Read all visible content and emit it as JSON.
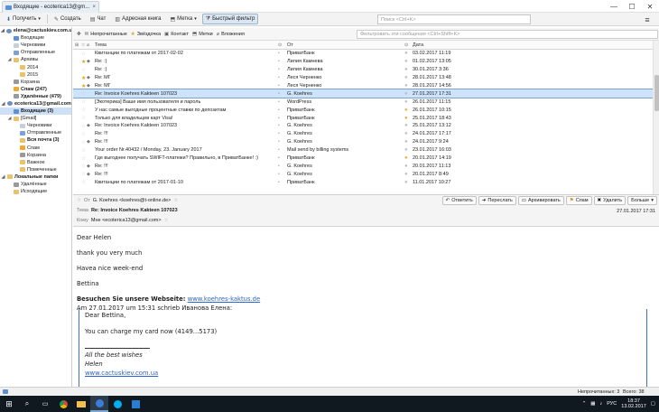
{
  "window": {
    "tab_title": "Входящие - ecoterica13@gm...",
    "close": "×",
    "minimize": "—",
    "maximize": "☐",
    "close_window": "✕"
  },
  "toolbar": {
    "get": "Получить",
    "create": "Создать",
    "chat": "Чат",
    "address_book": "Адресная книга",
    "tag": "Метка",
    "quick_filter": "Быстрый фильтр",
    "search_placeholder": "Поиск <Ctrl+K>",
    "menu_glyph": "≡"
  },
  "folders": [
    {
      "label": "elena@cactuskiev.com.ua",
      "indent": 0,
      "icon": "acct",
      "bold": true,
      "twisty": "◢"
    },
    {
      "label": "Входящие",
      "indent": 1,
      "icon": "inbox"
    },
    {
      "label": "Черновики",
      "indent": 1,
      "icon": "draft"
    },
    {
      "label": "Отправленные",
      "indent": 1,
      "icon": "sent"
    },
    {
      "label": "Архивы",
      "indent": 1,
      "icon": "folder",
      "twisty": "◢"
    },
    {
      "label": "2014",
      "indent": 2,
      "icon": "folder"
    },
    {
      "label": "2015",
      "indent": 2,
      "icon": "folder"
    },
    {
      "label": "Корзина",
      "indent": 1,
      "icon": "trash"
    },
    {
      "label": "Спам (247)",
      "indent": 1,
      "icon": "junk",
      "bold": true
    },
    {
      "label": "Удалённые (479)",
      "indent": 1,
      "icon": "trash",
      "bold": true
    },
    {
      "label": "ecoterica13@gmail.com",
      "indent": 0,
      "icon": "acct",
      "bold": true,
      "twisty": "◢"
    },
    {
      "label": "Входящие (3)",
      "indent": 1,
      "icon": "inbox",
      "bold": true,
      "selected": true
    },
    {
      "label": "[Gmail]",
      "indent": 1,
      "icon": "folder",
      "twisty": "◢"
    },
    {
      "label": "Черновики",
      "indent": 2,
      "icon": "draft"
    },
    {
      "label": "Отправленные",
      "indent": 2,
      "icon": "sent"
    },
    {
      "label": "Вся почта (3)",
      "indent": 2,
      "icon": "folder",
      "bold": true
    },
    {
      "label": "Спам",
      "indent": 2,
      "icon": "junk"
    },
    {
      "label": "Корзина",
      "indent": 2,
      "icon": "trash"
    },
    {
      "label": "Важное",
      "indent": 2,
      "icon": "folder"
    },
    {
      "label": "Помеченные",
      "indent": 2,
      "icon": "folder"
    },
    {
      "label": "Локальные папки",
      "indent": 0,
      "icon": "folder",
      "bold": true,
      "twisty": "◢"
    },
    {
      "label": "Удалённые",
      "indent": 1,
      "icon": "trash"
    },
    {
      "label": "Исходящие",
      "indent": 1,
      "icon": "folder"
    }
  ],
  "quickfilter": {
    "unread": "Непрочитанные",
    "starred": "Звёздочка",
    "contact": "Контакт",
    "tags": "Метки",
    "attachments": "Вложения",
    "search_placeholder": "Фильтровать эти сообщения <Ctrl+Shift+K>"
  },
  "thread_columns": {
    "subject": "Тема",
    "from": "От",
    "date": "Дата"
  },
  "messages": [
    {
      "star": false,
      "att": "",
      "subject": "Квитанции по платежам от 2017-02-02",
      "from": "ПриватБанк",
      "date": "03.02.2017 11:19"
    },
    {
      "star": true,
      "att": "◆",
      "subject": "Re: :)",
      "from": "Лилия Камнева",
      "date": "01.02.2017 13:05"
    },
    {
      "star": false,
      "att": "",
      "subject": "Re: :)",
      "from": "Лилия Камнева",
      "date": "30.01.2017 3:36"
    },
    {
      "star": true,
      "att": "◆",
      "subject": "Re: МГ",
      "from": "Леся Черненко",
      "date": "28.01.2017 13:48"
    },
    {
      "star": true,
      "att": "◆",
      "subject": "Re: МГ",
      "from": "Леся Черненко",
      "date": "28.01.2017 14:56"
    },
    {
      "star": false,
      "att": "",
      "subject": "Re: Invoice Koehres Kakteen 107023",
      "from": "G. Koehres",
      "date": "27.01.2017 17:31",
      "selected": true
    },
    {
      "star": false,
      "att": "",
      "subject": "[Экотерика] Ваше имя пользователя и пароль",
      "from": "WordPress",
      "date": "26.01.2017 11:15"
    },
    {
      "star": false,
      "att": "",
      "subject": "У нас самые выгодные процентные ставки по депозитам",
      "from": "ПриватБанк",
      "date": "26.01.2017 10:15",
      "dot": true
    },
    {
      "star": false,
      "att": "",
      "subject": "Только для владельцев карт Visa!",
      "from": "ПриватБанк",
      "date": "25.01.2017 18:43",
      "dot": true
    },
    {
      "star": false,
      "att": "◆",
      "subject": "Re: Invoice Koehres Kakteen 107023",
      "from": "G. Koehres",
      "date": "25.01.2017 13:12"
    },
    {
      "star": false,
      "att": "",
      "subject": "Re: !!!",
      "from": "G. Koehres",
      "date": "24.01.2017 17:17"
    },
    {
      "star": false,
      "att": "◆",
      "subject": "Re: !!!",
      "from": "G. Koehres",
      "date": "24.01.2017 9:24"
    },
    {
      "star": false,
      "att": "",
      "subject": "Your order Nr.40432 / Monday, 23. January 2017",
      "from": "Mail send by billing systems",
      "date": "23.01.2017 16:03"
    },
    {
      "star": false,
      "att": "",
      "subject": "Где выгоднее получать SWIFT-платежи? Правильно, в ПриватБанке! :)",
      "from": "ПриватБанк",
      "date": "20.01.2017 14:19",
      "dot": true
    },
    {
      "star": false,
      "att": "◆",
      "subject": "Re: !!!",
      "from": "G. Koehres",
      "date": "20.01.2017 11:13"
    },
    {
      "star": false,
      "att": "◆",
      "subject": "Re: !!!",
      "from": "G. Koehres",
      "date": "20.01.2017 8:49"
    },
    {
      "star": false,
      "att": "",
      "subject": "Квитанции по платежам от 2017-01-10",
      "from": "ПриватБанк",
      "date": "11.01.2017 10:27"
    }
  ],
  "header": {
    "from_label": "От",
    "from_value": "G. Koehres <koehres@t-online.de>",
    "subject_label": "Тема",
    "subject_value": "Re: Invoice Koehres Kakteen 107023",
    "to_label": "Кому",
    "to_value": "Мне <ecoterica13@gmail.com>",
    "date": "27.01.2017 17:31",
    "reply": "Ответить",
    "forward": "Переслать",
    "archive": "Архивировать",
    "spam": "Спам",
    "delete": "Удалить",
    "more": "Больше"
  },
  "body": {
    "p1": "Dear Helen",
    "p2": "thank you very much",
    "p3": "Havea nice week-end",
    "p4": "Bettina",
    "visit_label": "Besuchen Sie unsere Webseite:",
    "visit_link": "www.koehres-kaktus.de",
    "quote_intro": "Am 27.01.2017 um 15:31 schrieb Иванова Елена:",
    "q1": "Dear Bettina,",
    "q2": "You can charge my card now (4149...5173)",
    "q3": "All the best wishes",
    "q4": "Helen",
    "q5": "www.cactuskiev.com.ua"
  },
  "status": {
    "unread": "Непрочитанных: 3",
    "total": "Всего: 38"
  },
  "taskbar": {
    "lang": "РУС",
    "time": "18:37",
    "date": "13.02.2017"
  }
}
